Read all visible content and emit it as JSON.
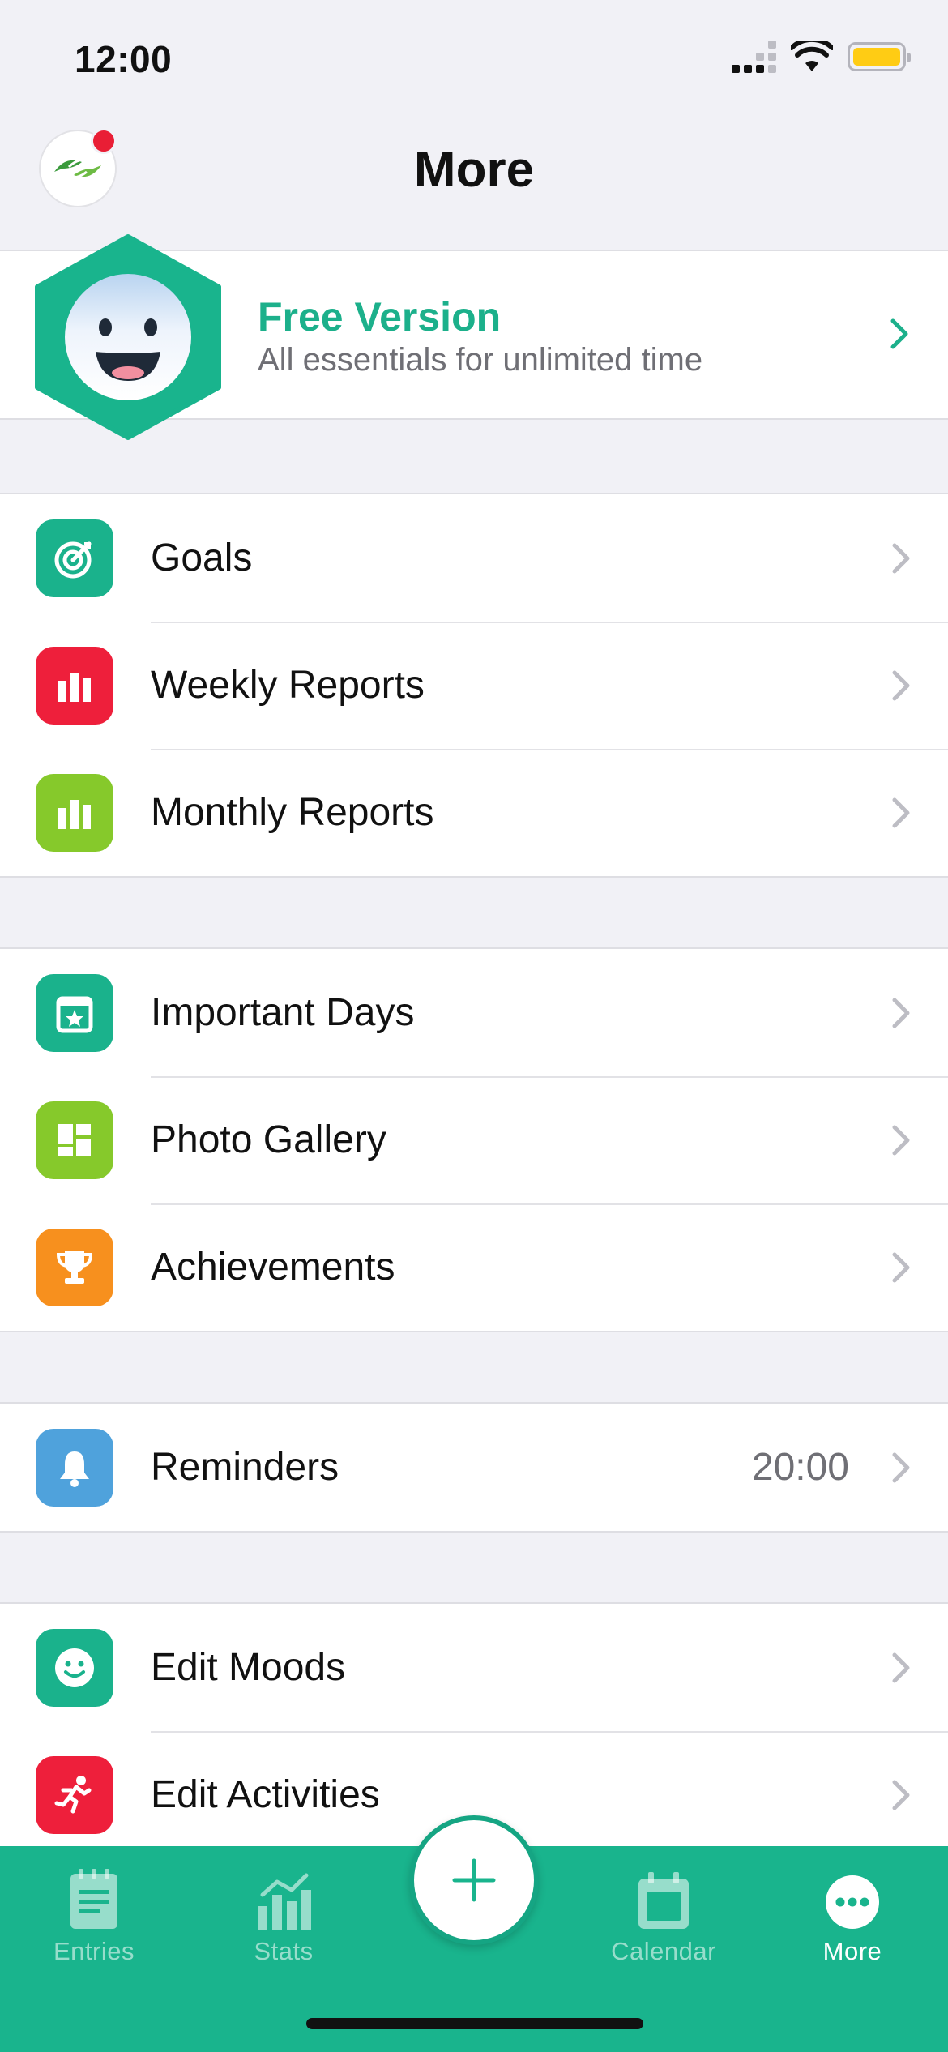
{
  "status_bar": {
    "time": "12:00"
  },
  "header": {
    "title": "More"
  },
  "premium": {
    "title": "Free Version",
    "subtitle": "All essentials for unlimited time"
  },
  "groups": [
    {
      "items": [
        {
          "label": "Goals",
          "icon": "target-icon",
          "color": "#1ab28c"
        },
        {
          "label": "Weekly Reports",
          "icon": "bar-chart-icon",
          "color": "#ee1f3b"
        },
        {
          "label": "Monthly Reports",
          "icon": "bar-chart-icon",
          "color": "#86c92b"
        }
      ]
    },
    {
      "items": [
        {
          "label": "Important Days",
          "icon": "calendar-star-icon",
          "color": "#1ab28c"
        },
        {
          "label": "Photo Gallery",
          "icon": "gallery-grid-icon",
          "color": "#86c92b"
        },
        {
          "label": "Achievements",
          "icon": "trophy-icon",
          "color": "#f7901e"
        }
      ]
    },
    {
      "items": [
        {
          "label": "Reminders",
          "value": "20:00",
          "icon": "bell-icon",
          "color": "#4fa2dc"
        }
      ]
    },
    {
      "items": [
        {
          "label": "Edit Moods",
          "icon": "smiley-icon",
          "color": "#1ab28c"
        },
        {
          "label": "Edit Activities",
          "icon": "running-icon",
          "color": "#ee1f3b"
        }
      ]
    }
  ],
  "tabbar": {
    "tabs": [
      {
        "label": "Entries",
        "icon": "entries-icon",
        "active": false
      },
      {
        "label": "Stats",
        "icon": "stats-icon",
        "active": false
      },
      {
        "label": "Calendar",
        "icon": "calendar-icon",
        "active": false
      },
      {
        "label": "More",
        "icon": "more-dots-icon",
        "active": true
      }
    ],
    "add_icon": "plus-icon"
  },
  "colors": {
    "accent": "#19b48d",
    "premium_title": "#1cb08b",
    "notification_dot": "#e91e35",
    "battery": "#ffcc14"
  }
}
